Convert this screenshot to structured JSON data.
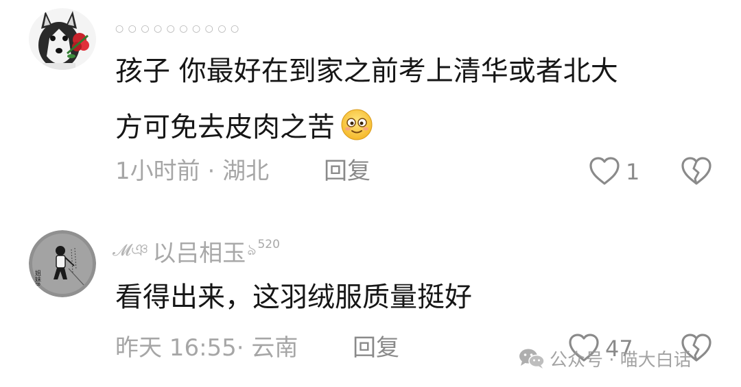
{
  "comments": [
    {
      "username": "○ ○ ○ ○ ○ ○ ○ ○ ○ ○",
      "avatar_icon": "husky-with-rose-avatar",
      "lines": [
        "孩子  你最好在到家之前考上清华或者北大",
        "方可免去皮肉之苦"
      ],
      "emoji": "smiling-emoji",
      "time": "1小时前",
      "separator": " · ",
      "location": "湖北",
      "reply_label": "回复",
      "like_count": "1"
    },
    {
      "username_prefix": "𝓜ঞ",
      "username": "以吕相玉",
      "username_suffix": "ঌ",
      "username_badge": "520",
      "avatar_icon": "cartoon-boy-avatar",
      "avatar_text": "姐妹8",
      "lines": [
        "看得出来，这羽绒服质量挺好"
      ],
      "time": "昨天 16:55",
      "separator": "· ",
      "location": "云南",
      "reply_label": "回复",
      "like_count": "47"
    }
  ],
  "watermark": {
    "icon": "wechat-icon",
    "text": "公众号 · 喵大白话"
  },
  "colors": {
    "text": "#161616",
    "meta": "#a6a6a6",
    "reply": "#8a8a8a",
    "icon": "#8a8a8a"
  }
}
